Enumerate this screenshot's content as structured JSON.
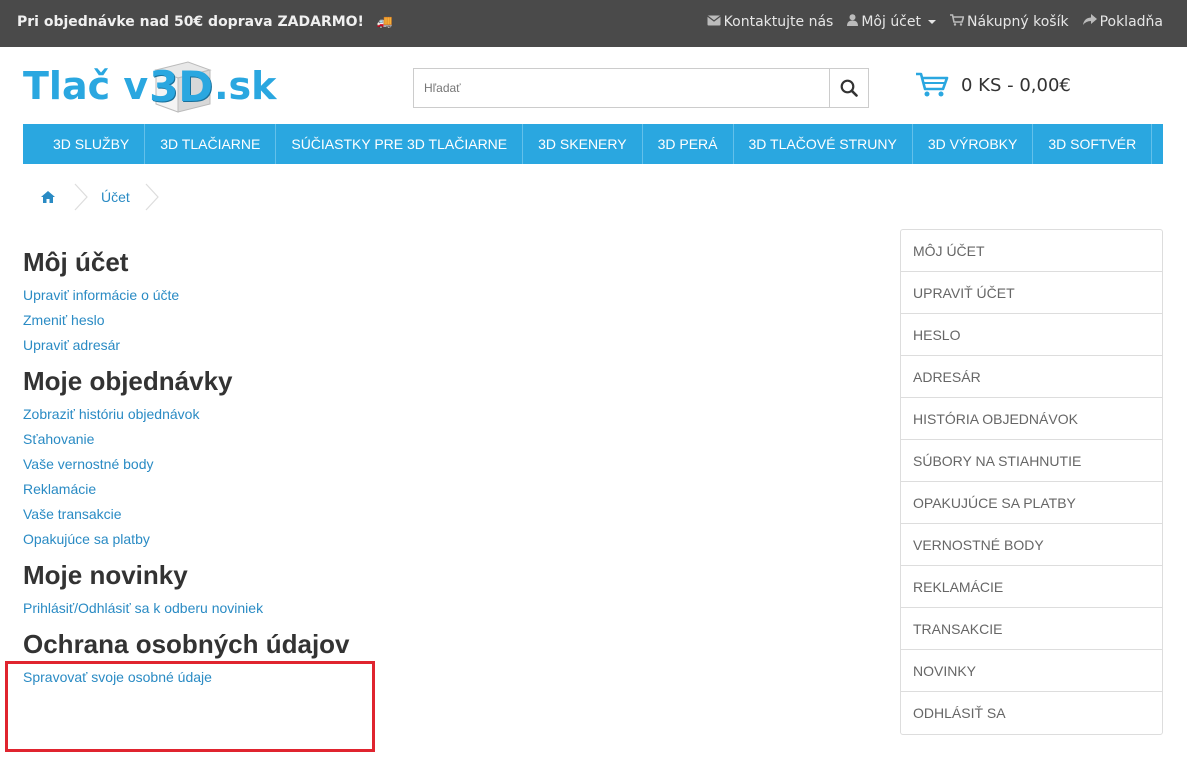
{
  "topbar": {
    "promo": "Pri objednávke nad 50€ doprava ZADARMO!",
    "links": {
      "contact": "Kontaktujte nás",
      "account": "Môj účet",
      "cart": "Nákupný košík",
      "checkout": "Pokladňa"
    }
  },
  "logo": {
    "pre": "Tlač v",
    "mid": "3D",
    "post": ".sk"
  },
  "search": {
    "placeholder": "Hľadať"
  },
  "cart": {
    "summary": "0 KS - 0,00€"
  },
  "nav": {
    "items": [
      "3D SLUŽBY",
      "3D TLAČIARNE",
      "SÚČIASTKY PRE 3D TLAČIARNE",
      "3D SKENERY",
      "3D PERÁ",
      "3D TLAČOVÉ STRUNY",
      "3D VÝROBKY",
      "3D SOFTVÉR"
    ]
  },
  "breadcrumb": {
    "current": "Účet"
  },
  "sections": [
    {
      "title": "Môj účet",
      "links": [
        "Upraviť informácie o účte",
        "Zmeniť heslo",
        "Upraviť adresár"
      ]
    },
    {
      "title": "Moje objednávky",
      "links": [
        "Zobraziť históriu objednávok",
        "Sťahovanie",
        "Vaše vernostné body",
        "Reklamácie",
        "Vaše transakcie",
        "Opakujúce sa platby"
      ]
    },
    {
      "title": "Moje novinky",
      "links": [
        "Prihlásiť/Odhlásiť sa k odberu noviniek"
      ]
    },
    {
      "title": "Ochrana osobných údajov",
      "links": [
        "Spravovať svoje osobné údaje"
      ]
    }
  ],
  "sidebar": {
    "items": [
      "MÔJ ÚČET",
      "UPRAVIŤ ÚČET",
      "HESLO",
      "ADRESÁR",
      "HISTÓRIA OBJEDNÁVOK",
      "SÚBORY NA STIAHNUTIE",
      "OPAKUJÚCE SA PLATBY",
      "VERNOSTNÉ BODY",
      "REKLAMÁCIE",
      "TRANSAKCIE",
      "NOVINKY",
      "ODHLÁSIŤ SA"
    ]
  },
  "colors": {
    "topbar_bg": "#4a4a4a",
    "accent": "#2aa7e0",
    "link": "#2a8bc4",
    "highlight": "#e0242f"
  }
}
